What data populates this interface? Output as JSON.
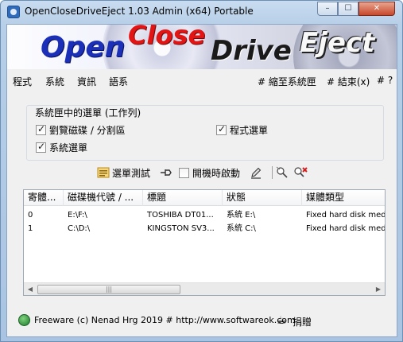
{
  "window": {
    "title": "OpenCloseDriveEject 1.03 Admin (x64) Portable",
    "controls": {
      "minimize": "–",
      "maximize": "☐",
      "close": "✕"
    }
  },
  "banner": {
    "open": "Open",
    "close": "Close",
    "drive": "Drive",
    "eject": "Eject"
  },
  "menu": {
    "items": [
      "程式",
      "系統",
      "資訊",
      "語系"
    ],
    "minimize_to_tray": "# 縮至系統匣",
    "exit": "# 結束(x)",
    "help": "# ?"
  },
  "group": {
    "title": "系統匣中的選單 (工作列)",
    "options": [
      {
        "label": "劉覽磁碟 / 分割區",
        "checked": true
      },
      {
        "label": "程式選單",
        "checked": true
      },
      {
        "label": "系統選單",
        "checked": true
      }
    ]
  },
  "toolbar": {
    "test_menu": "選單測試",
    "startup_label": "開機時啟動",
    "startup_checked": false
  },
  "table": {
    "headers": [
      "寄體...",
      "磁碟機代號 / ...",
      "標題",
      "狀態",
      "媒體類型"
    ],
    "rows": [
      [
        "0",
        "E:\\F:\\",
        "TOSHIBA DT01...",
        "系統 E:\\",
        "Fixed hard disk medi"
      ],
      [
        "1",
        "C:\\D:\\",
        "KINGSTON SV3...",
        "系統 C:\\",
        "Fixed hard disk medi"
      ]
    ],
    "scroll": {
      "left": "◀",
      "right": "▶",
      "grip": "|||"
    }
  },
  "footer": {
    "text": "Freeware (c) Nenad Hrg 2019 # http://www.softwareok.com",
    "donate": "捐贈"
  },
  "colors": {
    "open": "#1b2fb8",
    "close": "#e31414",
    "drive": "#1a1a1a",
    "eject": "#f8f8f8",
    "titlebar": "#b7cfe8"
  }
}
